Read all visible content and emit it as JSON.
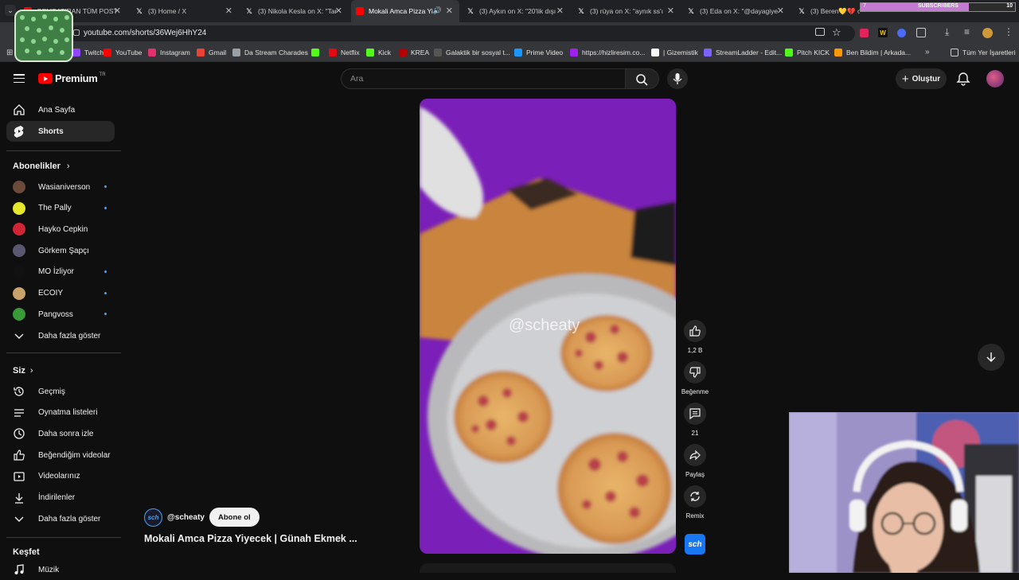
{
  "browser": {
    "tabs": [
      {
        "title": "GEMBATIRAN TÜM POST",
        "icon": "youtube-icon",
        "active": false
      },
      {
        "title": "(3) Home / X",
        "icon": "x-icon",
        "active": false
      },
      {
        "title": "(3) Nikola Kesla on X: \"Tar",
        "icon": "x-icon",
        "active": false
      },
      {
        "title": "Mokali Amca Pizza Yi",
        "icon": "youtube-icon",
        "active": true
      },
      {
        "title": "(3) Aykın on X: \"20'lik dışı",
        "icon": "x-icon",
        "active": false
      },
      {
        "title": "(3) rüya on X: \"aynık ss'ı",
        "icon": "x-icon",
        "active": false
      },
      {
        "title": "(3) Eda on X: \"@dayagiye",
        "icon": "x-icon",
        "active": false
      },
      {
        "title": "(3) Beren💛💔 on X: \"A",
        "icon": "x-icon",
        "active": false
      }
    ],
    "url": "youtube.com/shorts/36Wej6HhY24",
    "bookmarks": [
      {
        "label": "Twitch",
        "icon": "twitch-icon",
        "color": "#9146ff"
      },
      {
        "label": "YouTube",
        "icon": "youtube-icon",
        "color": "#ff0000"
      },
      {
        "label": "Instagram",
        "icon": "instagram-icon",
        "color": "#e1306c"
      },
      {
        "label": "Gmail",
        "icon": "gmail-icon",
        "color": "#ea4335"
      },
      {
        "label": "Da Stream Charades",
        "icon": "puzzle-icon",
        "color": "#9aa0a6"
      },
      {
        "label": "",
        "icon": "kick-icon",
        "color": "#53fc18"
      },
      {
        "label": "Netflix",
        "icon": "netflix-icon",
        "color": "#e50914"
      },
      {
        "label": "Kick",
        "icon": "kick-icon",
        "color": "#53fc18"
      },
      {
        "label": "KREA",
        "icon": "krea-icon",
        "color": "#b40000"
      },
      {
        "label": "Galaktik bir sosyal t...",
        "icon": "zk-icon",
        "color": "#555555"
      },
      {
        "label": "Prime Video",
        "icon": "prime-video-icon",
        "color": "#1a98ff"
      },
      {
        "label": "https://hizliresim.co...",
        "icon": "image-icon",
        "color": "#a020f0"
      },
      {
        "label": "| Gizemistik",
        "icon": "google-icon",
        "color": "#ffffff"
      },
      {
        "label": "StreamLadder - Edit...",
        "icon": "streamladder-icon",
        "color": "#7b61ff"
      },
      {
        "label": "Pitch KICK",
        "icon": "kick-icon",
        "color": "#53fc18"
      },
      {
        "label": "Ben Bildim | Arkada...",
        "icon": "pin-icon",
        "color": "#ff9800"
      }
    ],
    "all_bookmarks": "Tüm Yer İşaretleri",
    "subscribers_widget": {
      "label": "SUBSCRIBERS",
      "current": "7",
      "goal": "10",
      "progress": 0.7
    }
  },
  "youtube": {
    "logo": "Premium",
    "logo_suffix": "TR",
    "search_placeholder": "Ara",
    "create_label": "Oluştur",
    "sidebar": {
      "main": [
        {
          "label": "Ana Sayfa",
          "icon": "home-icon"
        },
        {
          "label": "Shorts",
          "icon": "shorts-icon",
          "active": true
        }
      ],
      "subscriptions_header": "Abonelikler",
      "subscriptions": [
        {
          "label": "Wasianiverson",
          "dot": true
        },
        {
          "label": "The Pally",
          "dot": true
        },
        {
          "label": "Hayko Cepkin",
          "dot": false
        },
        {
          "label": "Görkem Şapçı",
          "dot": false
        },
        {
          "label": "MO İzliyor",
          "dot": true
        },
        {
          "label": "ECOIY",
          "dot": true
        },
        {
          "label": "Pangvoss",
          "dot": true
        }
      ],
      "show_more": "Daha fazla göster",
      "you_header": "Siz",
      "you_items": [
        {
          "label": "Geçmiş",
          "icon": "history-icon"
        },
        {
          "label": "Oynatma listeleri",
          "icon": "playlist-icon"
        },
        {
          "label": "Daha sonra izle",
          "icon": "clock-icon"
        },
        {
          "label": "Beğendiğim videolar",
          "icon": "thumbs-up-icon"
        },
        {
          "label": "Videolarınız",
          "icon": "video-icon"
        },
        {
          "label": "İndirilenler",
          "icon": "download-icon"
        },
        {
          "label": "Daha fazla göster",
          "icon": "chevron-down-icon"
        }
      ],
      "explore_header": "Keşfet",
      "explore_items": [
        {
          "label": "Müzik",
          "icon": "music-icon"
        }
      ]
    },
    "short": {
      "watermark": "@scheaty",
      "channel": "@scheaty",
      "subscribe_label": "Abone ol",
      "title": "Mokali Amca Pizza Yiyecek | Günah Ekmek ...",
      "actions": {
        "like_count": "1,2 B",
        "dislike_label": "Beğenme",
        "comment_count": "21",
        "share_label": "Paylaş",
        "remix_label": "Remix"
      }
    }
  }
}
